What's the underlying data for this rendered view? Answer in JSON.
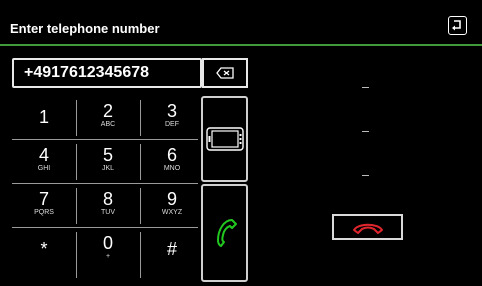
{
  "header": {
    "title": "Enter telephone number",
    "back_icon": "return-arrow-icon"
  },
  "input": {
    "value": "+4917612345678",
    "backspace_icon": "backspace-icon"
  },
  "keypad": {
    "keys": [
      {
        "digit": "1",
        "letters": ""
      },
      {
        "digit": "2",
        "letters": "ABC"
      },
      {
        "digit": "3",
        "letters": "DEF"
      },
      {
        "digit": "4",
        "letters": "GHI"
      },
      {
        "digit": "5",
        "letters": "JKL"
      },
      {
        "digit": "6",
        "letters": "MNO"
      },
      {
        "digit": "7",
        "letters": "PQRS"
      },
      {
        "digit": "8",
        "letters": "TUV"
      },
      {
        "digit": "9",
        "letters": "WXYZ"
      },
      {
        "digit": "*",
        "letters": ""
      },
      {
        "digit": "0",
        "letters": "+"
      },
      {
        "digit": "#",
        "letters": ""
      }
    ]
  },
  "side_buttons": {
    "phone_icon": "mobile-phone-icon",
    "call_icon": "call-handset-icon"
  },
  "calls": {
    "slots": [
      "--",
      "--",
      "--"
    ],
    "end_call_icon": "end-call-icon"
  },
  "colors": {
    "accent": "#3f9b3a",
    "call": "#22c81f",
    "end_call": "#e0262c"
  }
}
